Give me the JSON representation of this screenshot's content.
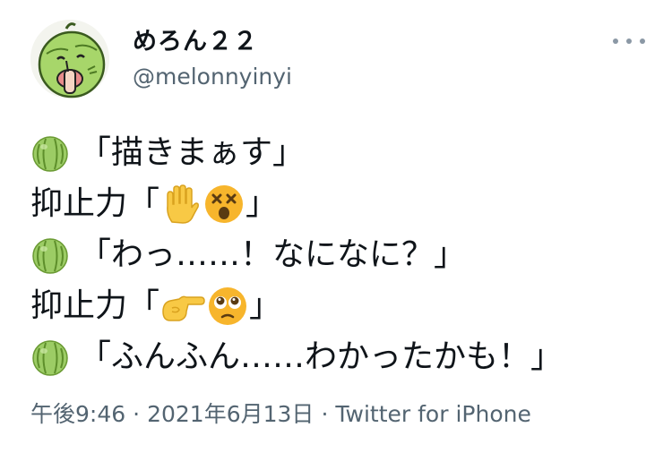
{
  "author": {
    "display_name": "めろん２２",
    "handle": "@melonnyinyi"
  },
  "tweet": {
    "lines": [
      {
        "emojis_before": [
          "melon"
        ],
        "text": "「描きまぁす」"
      },
      {
        "text": "抑止力「",
        "emojis_after": [
          "raised-hand",
          "dizzy-face"
        ],
        "text_after": "」"
      },
      {
        "emojis_before": [
          "melon"
        ],
        "text": "「わっ……！なになに？」"
      },
      {
        "text": "抑止力「",
        "emojis_after": [
          "pointing-right-hand",
          "pleading-face"
        ],
        "text_after": "」"
      },
      {
        "emojis_before": [
          "melon"
        ],
        "text": "「ふんふん……わかったかも！」"
      }
    ]
  },
  "meta": {
    "time": "午後9:46",
    "date": "2021年6月13日",
    "source": "Twitter for iPhone",
    "separator": "·"
  },
  "colors": {
    "text": "#0f1419",
    "secondary": "#536471",
    "melon": "#8bc34a",
    "emoji_yellow": "#f5b82e"
  }
}
